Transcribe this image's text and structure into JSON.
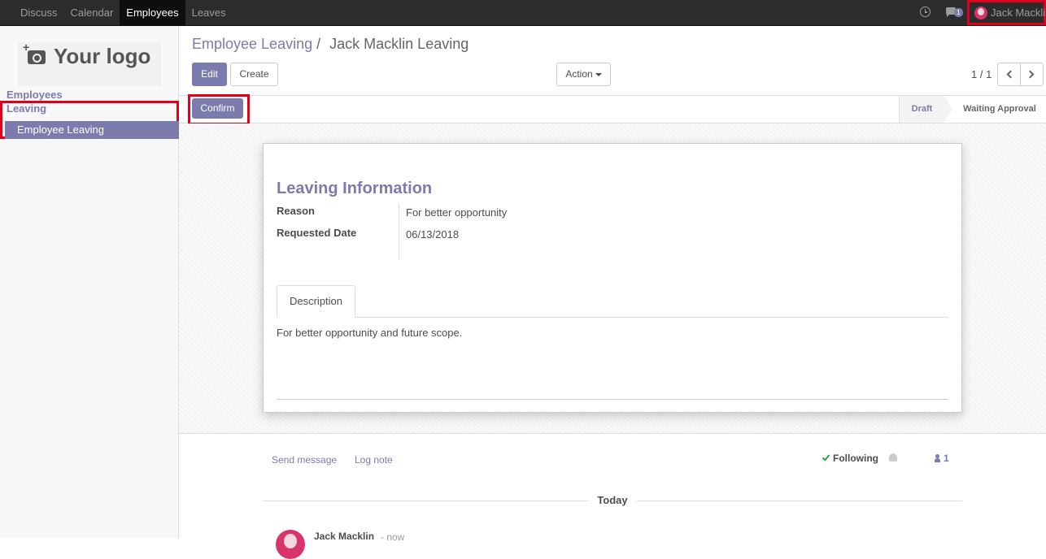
{
  "topbar": {
    "menu": [
      "Discuss",
      "Calendar",
      "Employees",
      "Leaves"
    ],
    "active": "Employees",
    "messages_badge": "1",
    "user_name": "Jack Macklin"
  },
  "sidebar": {
    "logo_text": "Your logo",
    "section1": "Employees",
    "section2": "Leaving",
    "active_item": "Employee Leaving"
  },
  "breadcrumb": {
    "parent": "Employee Leaving",
    "separator": "/",
    "current": "Jack Macklin Leaving"
  },
  "toolbar": {
    "edit": "Edit",
    "create": "Create",
    "action": "Action",
    "pager": "1 / 1"
  },
  "statusbar": {
    "confirm": "Confirm",
    "stages": [
      "Draft",
      "Waiting Approval"
    ],
    "current_stage": "Draft"
  },
  "form": {
    "section_title": "Leaving Information",
    "reason_label": "Reason",
    "reason_value": "For better opportunity",
    "date_label": "Requested Date",
    "date_value": "06/13/2018",
    "tab_label": "Description",
    "description": "For better opportunity and future scope."
  },
  "chatter": {
    "send_message": "Send message",
    "log_note": "Log note",
    "following": "Following",
    "followers_count": "1",
    "today": "Today",
    "author": "Jack Macklin",
    "time": "- now"
  },
  "colors": {
    "accent": "#7c7bad",
    "highlight_box": "#e0001b",
    "topbar": "#2c2c2c"
  }
}
